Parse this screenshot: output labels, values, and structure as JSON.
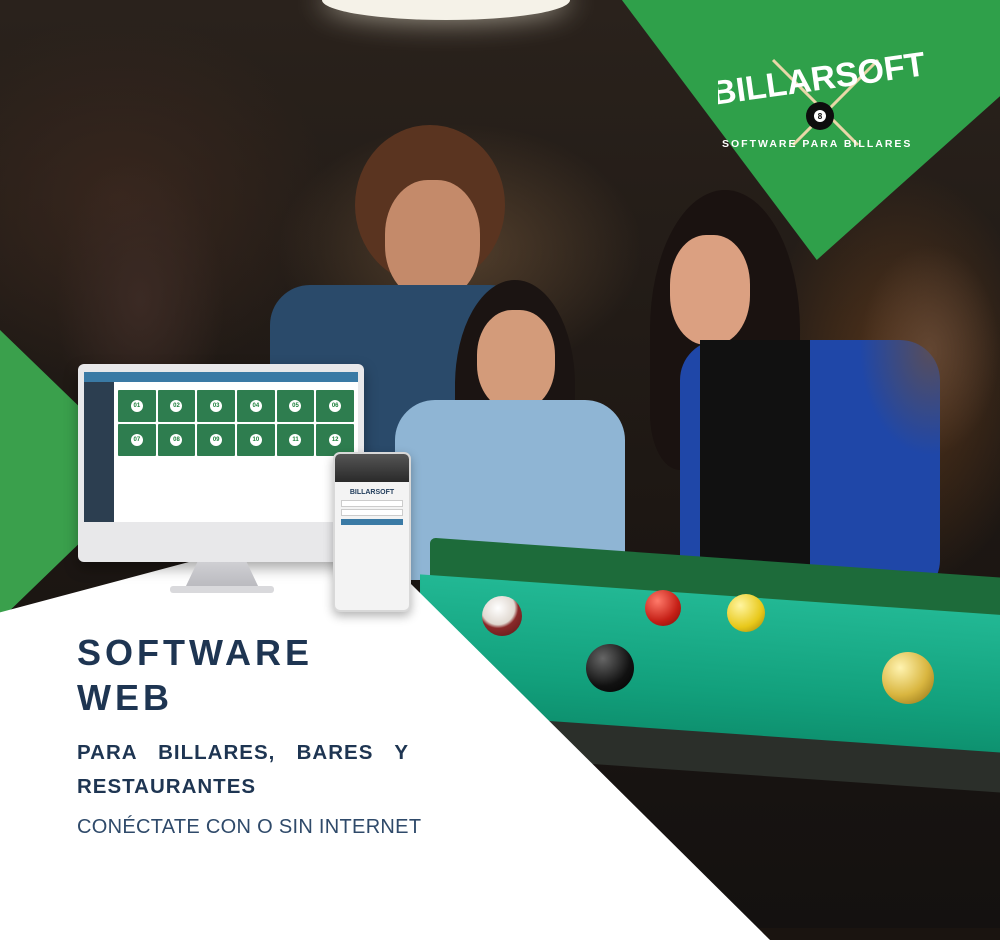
{
  "brand": {
    "name": "BILLARSOFT",
    "tagline": "SOFTWARE PARA BILLARES",
    "ball_number": "8",
    "colors": {
      "primary_green": "#2fa04a",
      "navy": "#1e3552",
      "felt": "#12a07c"
    }
  },
  "headline": {
    "line1": "SOFTWARE",
    "line2": "WEB",
    "subtitle": "PARA BILLARES, BARES Y RESTAURANTES",
    "note": "CONÉCTATE CON O SIN INTERNET"
  },
  "monitor_screen": {
    "mesas": [
      "01",
      "02",
      "03",
      "04",
      "05",
      "06",
      "07",
      "08",
      "09",
      "10",
      "11",
      "12"
    ]
  }
}
